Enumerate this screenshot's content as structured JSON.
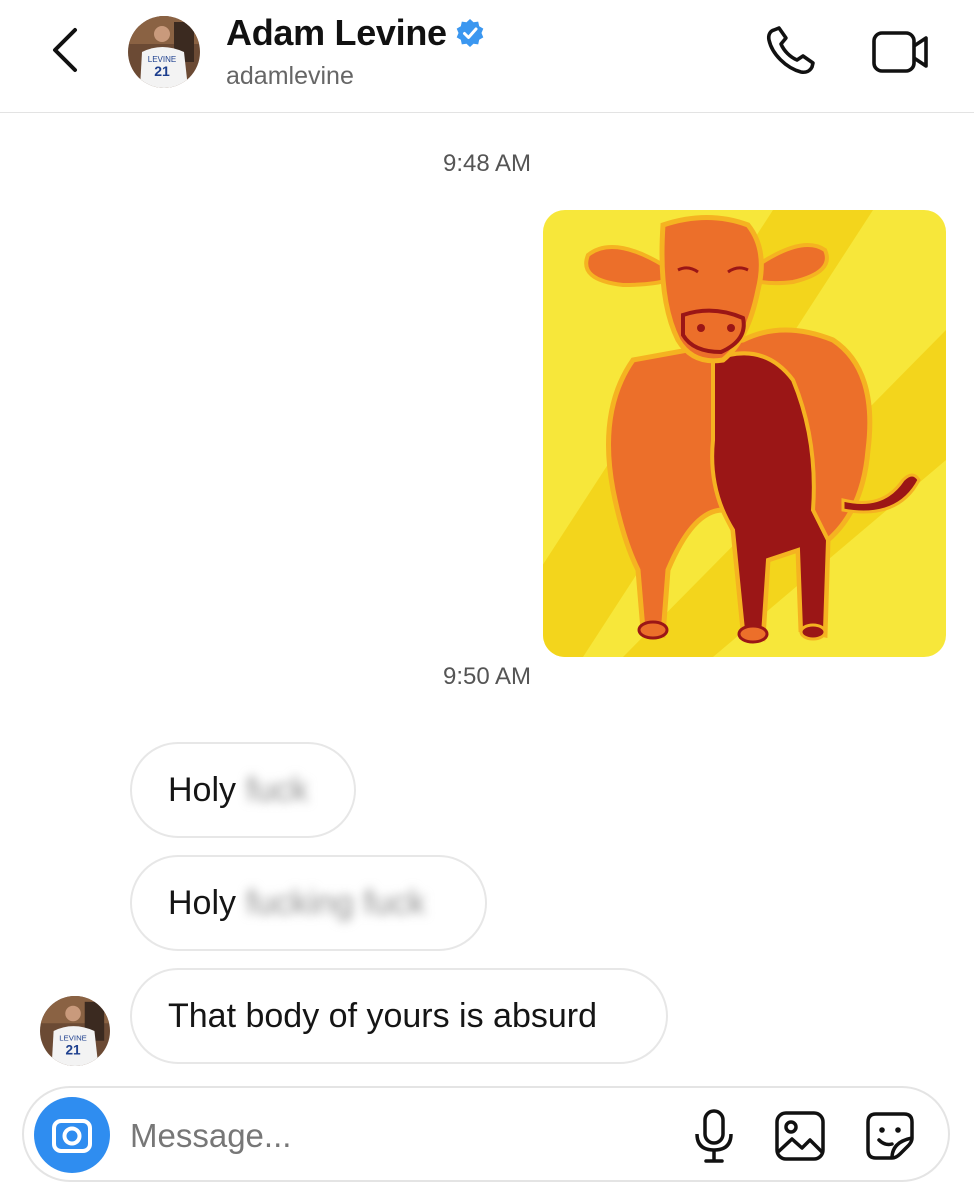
{
  "header": {
    "name": "Adam Levine",
    "handle": "adamlevine",
    "verified": true,
    "icons": {
      "back": "chevron-left-icon",
      "call": "phone-icon",
      "video": "video-camera-icon",
      "verified": "verified-badge-icon"
    },
    "avatar_jersey_name": "LEVINE",
    "avatar_jersey_number": "21"
  },
  "thread": {
    "timestamps": [
      "9:48 AM",
      "9:50 AM"
    ],
    "sent_image": {
      "description_icon": "cow-illustration-image",
      "colors": {
        "background": "#f7e73a",
        "stripes": "#f2d21a",
        "body": "#ec6f2a",
        "shadow": "#9b1616",
        "outline": "#f5b321"
      }
    },
    "received": [
      {
        "visible": "Holy",
        "blurred": "fuck"
      },
      {
        "visible": "Holy",
        "blurred": "fucking fuck"
      },
      {
        "visible": "That body of yours is absurd",
        "blurred": ""
      }
    ]
  },
  "composer": {
    "placeholder": "Message...",
    "icons": {
      "camera": "camera-icon",
      "mic": "microphone-icon",
      "gallery": "gallery-icon",
      "sticker": "sticker-icon"
    },
    "accent": "#2f8df0"
  }
}
